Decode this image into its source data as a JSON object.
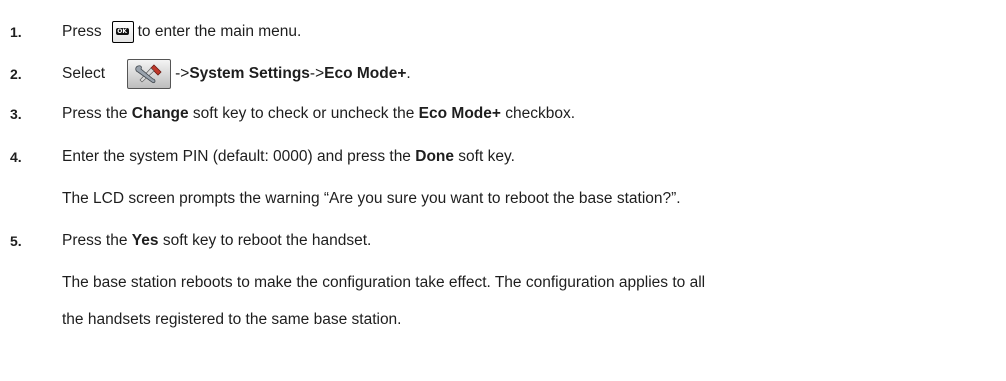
{
  "steps": [
    {
      "number": "1.",
      "before": "Press",
      "after": "to enter the main menu."
    },
    {
      "number": "2.",
      "before": "Select",
      "path_prefix": "->",
      "path_1": "System Settings",
      "path_sep": "->",
      "path_2": "Eco Mode+",
      "path_end": "."
    },
    {
      "number": "3.",
      "t1": "Press the ",
      "b1": "Change",
      "t2": " soft key to check or uncheck the ",
      "b2": "Eco Mode+",
      "t3": " checkbox."
    },
    {
      "number": "4.",
      "t1": "Enter the system PIN (default: 0000) and press the ",
      "b1": "Done",
      "t2": " soft key."
    },
    {
      "number": "5.",
      "t1": "Press the ",
      "b1": "Yes",
      "t2": " soft key to reboot the handset."
    }
  ],
  "notes": {
    "step4_result": "The LCD screen prompts the warning “Are you sure you want to reboot the base station?”.",
    "step5_result_line1": "The base station reboots to make the configuration take effect. The configuration applies to all",
    "step5_result_line2": "the handsets registered to the same base station."
  },
  "icons": {
    "ok_key": "ok-key-icon",
    "ok_key_text": "OK",
    "settings": "settings-tools-icon"
  }
}
